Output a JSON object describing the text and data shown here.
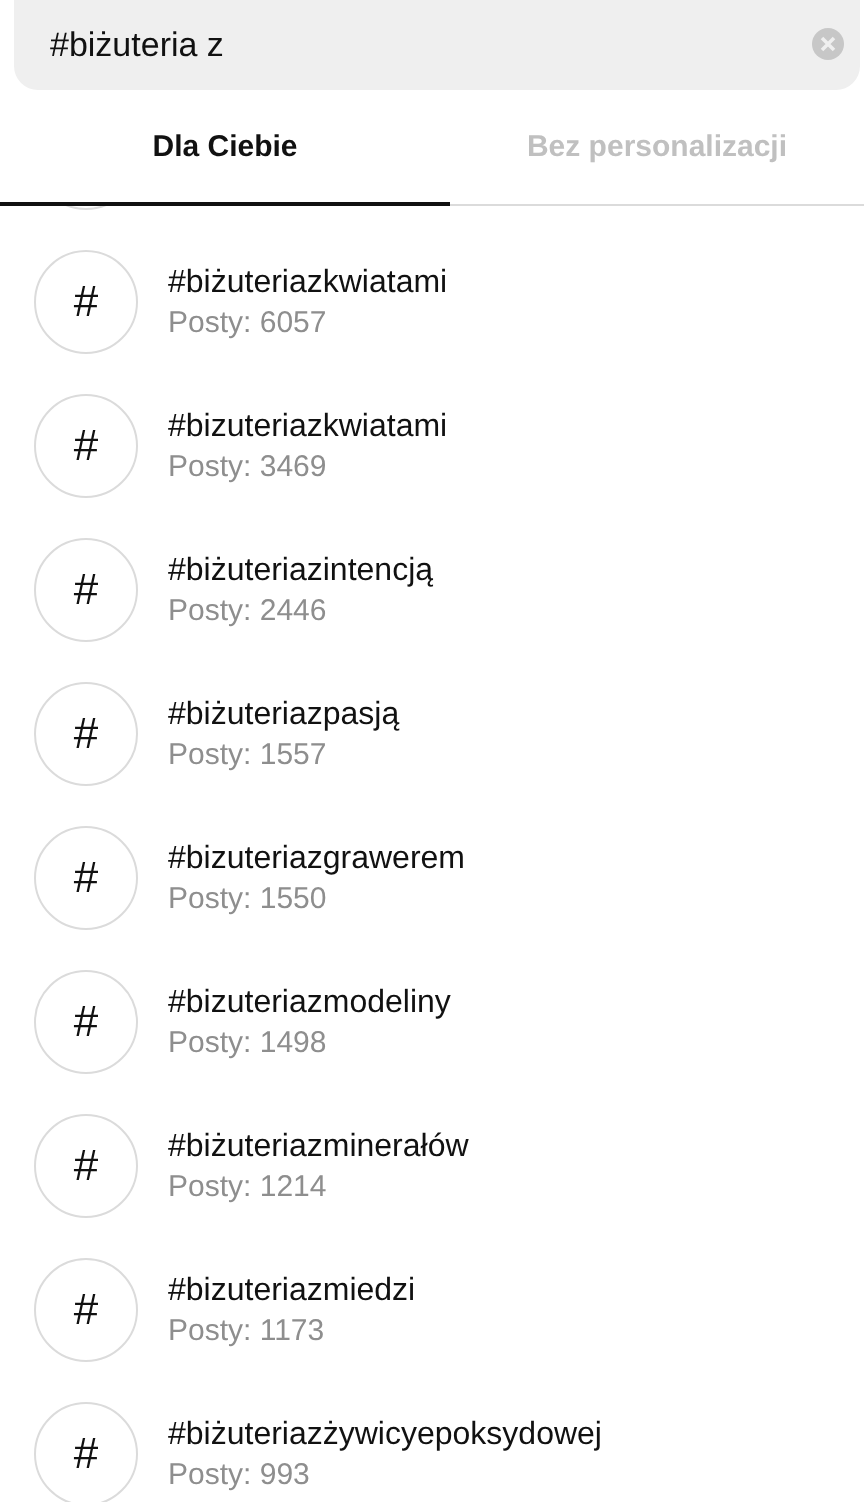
{
  "search": {
    "value": "#biżuteria z"
  },
  "tabs": [
    {
      "label": "Dla Ciebie",
      "selected": true
    },
    {
      "label": "Bez personalizacji",
      "selected": false
    }
  ],
  "results": [
    {
      "icon": "#",
      "name": "#biżuteriazkwiatami",
      "posts": "Posty: 6057"
    },
    {
      "icon": "#",
      "name": "#bizuteriazkwiatami",
      "posts": "Posty: 3469"
    },
    {
      "icon": "#",
      "name": "#biżuteriazintencją",
      "posts": "Posty: 2446"
    },
    {
      "icon": "#",
      "name": "#biżuteriazpasją",
      "posts": "Posty: 1557"
    },
    {
      "icon": "#",
      "name": "#bizuteriazgrawerem",
      "posts": "Posty: 1550"
    },
    {
      "icon": "#",
      "name": "#bizuteriazmodeliny",
      "posts": "Posty: 1498"
    },
    {
      "icon": "#",
      "name": "#biżuteriazminerałów",
      "posts": "Posty: 1214"
    },
    {
      "icon": "#",
      "name": "#bizuteriazmiedzi",
      "posts": "Posty: 1173"
    },
    {
      "icon": "#",
      "name": "#biżuteriazżywicyepoksydowej",
      "posts": "Posty: 993"
    }
  ]
}
